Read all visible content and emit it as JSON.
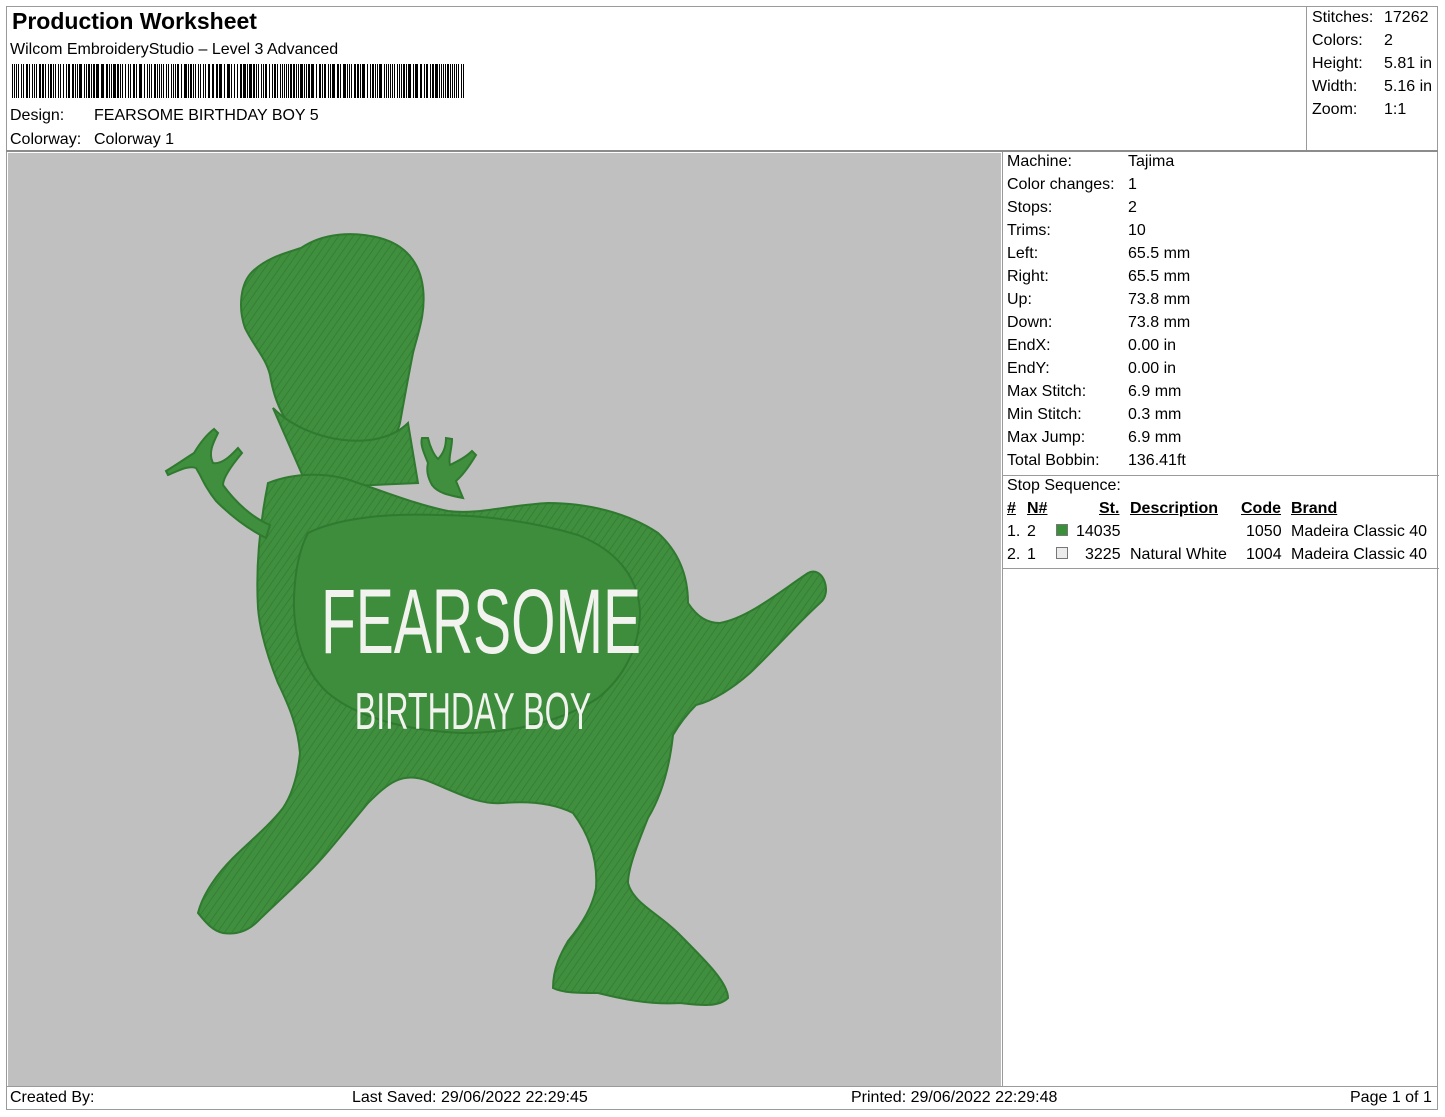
{
  "header": {
    "title": "Production Worksheet",
    "software": "Wilcom EmbroideryStudio – Level 3 Advanced",
    "design_label": "Design:",
    "design_value": "FEARSOME BIRTHDAY BOY 5",
    "colorway_label": "Colorway:",
    "colorway_value": "Colorway 1"
  },
  "summary": [
    {
      "label": "Stitches:",
      "value": "17262"
    },
    {
      "label": "Colors:",
      "value": "2"
    },
    {
      "label": "Height:",
      "value": "5.81 in"
    },
    {
      "label": "Width:",
      "value": "5.16 in"
    },
    {
      "label": "Zoom:",
      "value": "1:1"
    }
  ],
  "properties": [
    {
      "label": "Machine:",
      "value": "Tajima"
    },
    {
      "label": "Color changes:",
      "value": "1"
    },
    {
      "label": "Stops:",
      "value": "2"
    },
    {
      "label": "Trims:",
      "value": "10"
    },
    {
      "label": "Left:",
      "value": "65.5 mm"
    },
    {
      "label": "Right:",
      "value": "65.5 mm"
    },
    {
      "label": "Up:",
      "value": "73.8 mm"
    },
    {
      "label": "Down:",
      "value": "73.8 mm"
    },
    {
      "label": "EndX:",
      "value": "0.00 in"
    },
    {
      "label": "EndY:",
      "value": "0.00 in"
    },
    {
      "label": "Max Stitch:",
      "value": "6.9 mm"
    },
    {
      "label": "Min Stitch:",
      "value": "0.3 mm"
    },
    {
      "label": "Max Jump:",
      "value": "6.9 mm"
    },
    {
      "label": "Total Bobbin:",
      "value": "136.41ft"
    }
  ],
  "stop_sequence": {
    "title": "Stop Sequence:",
    "columns": {
      "num": "#",
      "needle": "N#",
      "stitches": "St.",
      "description": "Description",
      "code": "Code",
      "brand": "Brand"
    },
    "rows": [
      {
        "num": "1.",
        "needle": "2",
        "color": "#3a8f3a",
        "stitches": "14035",
        "description": "",
        "code": "1050",
        "brand": "Madeira Classic 40"
      },
      {
        "num": "2.",
        "needle": "1",
        "color": "#ececec",
        "stitches": "3225",
        "description": "Natural White",
        "code": "1004",
        "brand": "Madeira Classic 40"
      }
    ]
  },
  "design_preview": {
    "line1": "FEARSOME",
    "line2": "BIRTHDAY BOY",
    "thread_color": "#3f8f3f",
    "text_color": "#f2f2ef",
    "background": "#c0c0c0"
  },
  "footer": {
    "created_by": "Created By:",
    "last_saved": "Last Saved: 29/06/2022 22:29:45",
    "printed": "Printed: 29/06/2022 22:29:48",
    "page": "Page 1 of 1"
  }
}
